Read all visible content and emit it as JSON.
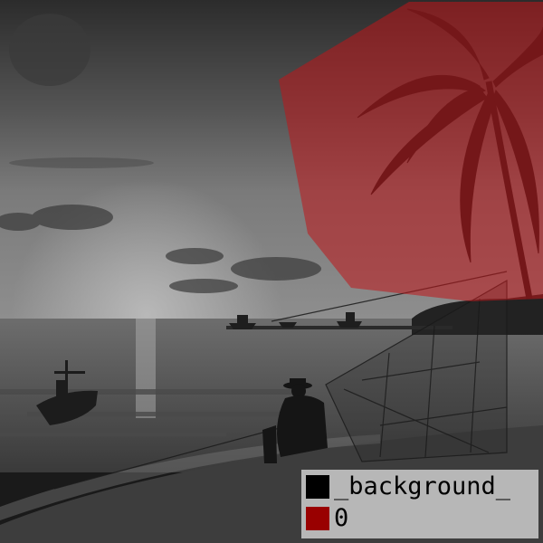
{
  "legend": {
    "items": [
      {
        "label": "_background_",
        "color": "#000000"
      },
      {
        "label": "0",
        "color": "#990000"
      }
    ]
  },
  "mask_color": "#c0151a",
  "scene_subjects": [
    "sky",
    "sea",
    "boat-left",
    "boats-horizon",
    "fisherman",
    "fishing-net",
    "palm-tree",
    "beach"
  ]
}
